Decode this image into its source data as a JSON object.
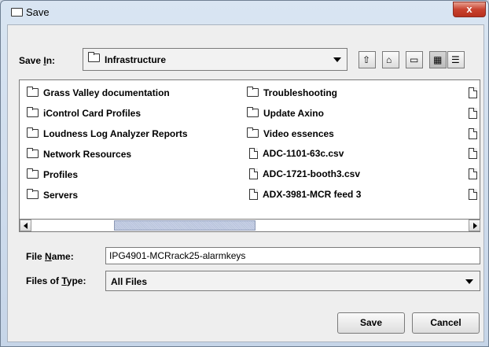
{
  "window": {
    "title": "Save",
    "close_glyph": "x"
  },
  "save_in": {
    "label_prefix": "Save ",
    "label_mnemonic": "I",
    "label_suffix": "n:",
    "value": "Infrastructure"
  },
  "toolbar": {
    "buttons": [
      {
        "name": "up-one-level-icon",
        "glyph": "⇧"
      },
      {
        "name": "home-icon",
        "glyph": "⌂"
      },
      {
        "name": "new-folder-icon",
        "glyph": "▭"
      },
      {
        "name": "list-view-icon",
        "glyph": "▦"
      },
      {
        "name": "details-view-icon",
        "glyph": "☰"
      }
    ],
    "active_index": 3
  },
  "files": {
    "column1": [
      {
        "type": "folder",
        "name": "Grass Valley documentation"
      },
      {
        "type": "folder",
        "name": "iControl Card Profiles"
      },
      {
        "type": "folder",
        "name": "Loudness Log Analyzer Reports"
      },
      {
        "type": "folder",
        "name": "Network Resources"
      },
      {
        "type": "folder",
        "name": "Profiles"
      },
      {
        "type": "folder",
        "name": "Servers"
      }
    ],
    "column2": [
      {
        "type": "folder",
        "name": "Troubleshooting"
      },
      {
        "type": "folder",
        "name": "Update Axino"
      },
      {
        "type": "folder",
        "name": "Video essences"
      },
      {
        "type": "file",
        "name": "ADC-1101-63c.csv"
      },
      {
        "type": "file",
        "name": "ADC-1721-booth3.csv"
      },
      {
        "type": "file",
        "name": "ADX-3981-MCR feed 3"
      }
    ]
  },
  "file_name": {
    "label_prefix": "File ",
    "label_mnemonic": "N",
    "label_suffix": "ame:",
    "value": "IPG4901-MCRrack25-alarmkeys"
  },
  "file_type": {
    "label_prefix": "Files of ",
    "label_mnemonic": "T",
    "label_suffix": "ype:",
    "value": "All Files"
  },
  "actions": {
    "save": "Save",
    "cancel": "Cancel"
  }
}
